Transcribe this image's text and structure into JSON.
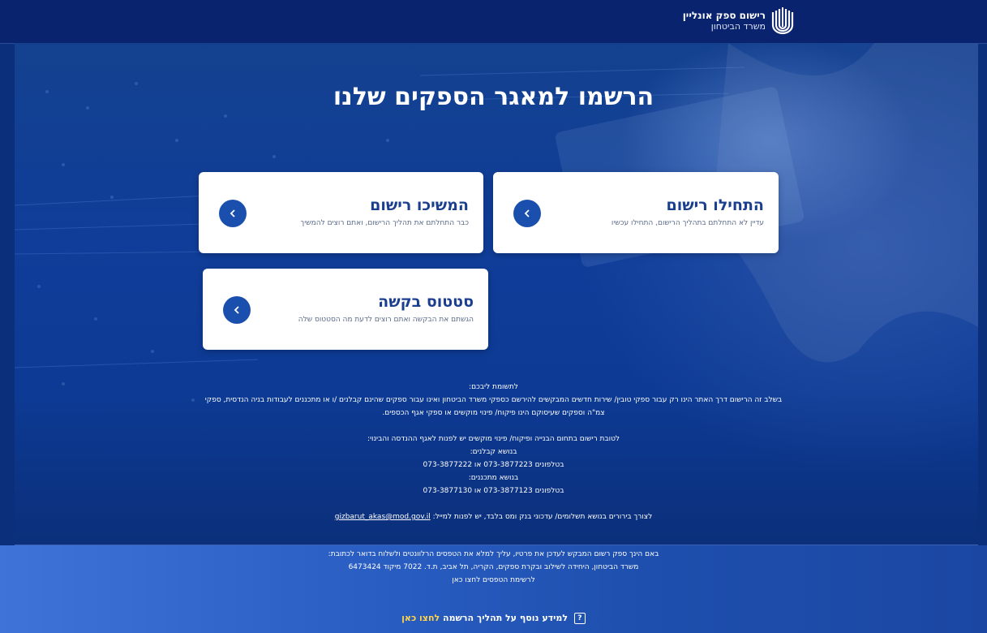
{
  "header": {
    "brand_title": "רישום ספק אונליין",
    "brand_subtitle": "משרד הביטחון",
    "logo_icon": "ministry-emblem-icon"
  },
  "hero": {
    "headline": "הרשמו למאגר הספקים שלנו"
  },
  "cards": {
    "start": {
      "title": "התחילו רישום",
      "description": "עדיין לא התחלתם בתהליך הרישום, התחילו עכשיו",
      "icon": "chevron-left-icon"
    },
    "continue": {
      "title": "המשיכו רישום",
      "description": "כבר התחלתם את תהליך הרישום, ואתם רוצים להמשיך",
      "icon": "chevron-left-icon"
    },
    "status": {
      "title": "סטטוס בקשה",
      "description": "הגשתם את הבקשה ואתם רוצים לדעת מה הסטטוס שלה",
      "icon": "chevron-left-icon"
    }
  },
  "notice": {
    "heading": "לתשומת ליבכם:",
    "line1": "בשלב זה הרישום דרך האתר הינו רק עבור ספקי טובין/ שירות חדשים המבקשים להירשם כספקי משרד הביטחון ואינו עבור ספקים שהינם קבלנים /ו או מתכננים לעבודות בניה הנדסית, ספקי",
    "line2": "צמ\"ה וספקים שעיסוקם הינו פיקוח/ פינוי מוקשים או ספקי אגף הכספים.",
    "line3": "לטובת רישום בתחום הבנייה ופיקוח/ פינוי מוקשים יש לפנות לאגף ההנדסה והבינוי:",
    "contractors_label": "בנושא קבלנים:",
    "contractors_phones": "בטלפונים 073-3877223 או 073-3877222",
    "planners_label": "בנושא מתכננים:",
    "planners_phones": "בטלפונים 073-3877123 או 073-3877130",
    "payments_text": "לצורך בירורים בנושא תשלומים/ עדכוני בנק ומס בלבד, יש לפנות למייל:",
    "payments_email": "gizbarut_akas@mod.gov.il"
  },
  "footer": {
    "line1": "באם הינך ספק רשום המבקש לעדכן את פרטיו, עליך למלא את הטפסים הרלוונטים ולשלוח בדואר לכתובת:",
    "line2": "משרד הביטחון, היחידה לשילוב ובקרת ספקים, הקריה, תל אביב, ת.ד. 7022 מיקוד 6473424",
    "line3": "לרשימת הטפסים לחצו כאן",
    "more_info_label": "למידע נוסף על תהליך הרשמה",
    "more_info_link": "לחצו כאן",
    "more_info_icon": "question-icon"
  }
}
